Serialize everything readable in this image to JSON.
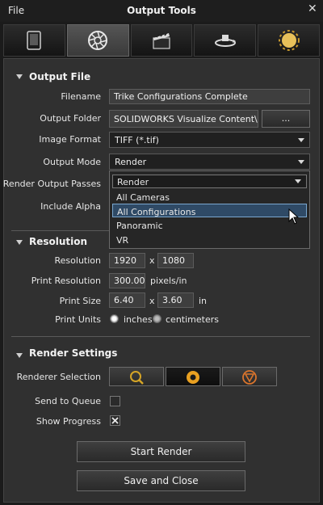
{
  "window": {
    "menu_file": "File",
    "title": "Output Tools",
    "close_glyph": "✕"
  },
  "tabs": [
    {
      "icon": "tablet-icon",
      "active": false
    },
    {
      "icon": "camera-aperture-icon",
      "active": true
    },
    {
      "icon": "clapperboard-icon",
      "active": false
    },
    {
      "icon": "turntable-icon",
      "active": false
    },
    {
      "icon": "sun-icon",
      "active": false
    }
  ],
  "output_file": {
    "heading": "Output File",
    "filename_label": "Filename",
    "filename_value": "Trike Configurations Complete",
    "output_folder_label": "Output Folder",
    "output_folder_value": "SOLIDWORKS Visualize Content\\Images",
    "browse_label": "...",
    "image_format_label": "Image Format",
    "image_format_value": "TIFF (*.tif)",
    "output_mode_label": "Output Mode",
    "output_mode_value": "Render",
    "render_output_passes_label": "Render Output Passes",
    "include_alpha_label": "Include Alpha"
  },
  "output_mode_dropdown": {
    "header": "Render",
    "options": [
      "All Cameras",
      "All Configurations",
      "Panoramic",
      "VR"
    ],
    "selected_index": 1
  },
  "resolution": {
    "heading": "Resolution",
    "resolution_label": "Resolution",
    "width": "1920",
    "x1": "x",
    "height": "1080",
    "print_resolution_label": "Print Resolution",
    "print_resolution_value": "300.00",
    "print_resolution_unit": "pixels/in",
    "print_size_label": "Print Size",
    "print_width": "6.40",
    "x2": "x",
    "print_height": "3.60",
    "print_size_unit": "in",
    "print_units_label": "Print Units",
    "unit_inches": "inches",
    "unit_centimeters": "centimeters",
    "selected_unit": "inches"
  },
  "render_settings": {
    "heading": "Render Settings",
    "renderer_selection_label": "Renderer Selection",
    "renderers": [
      "preview-renderer-icon",
      "fast-renderer-icon",
      "accurate-renderer-icon"
    ],
    "active_renderer_index": 1,
    "send_to_queue_label": "Send to Queue",
    "send_to_queue_checked": false,
    "show_progress_label": "Show Progress",
    "show_progress_checked": true
  },
  "actions": {
    "start_render": "Start Render",
    "save_and_close": "Save and Close"
  }
}
